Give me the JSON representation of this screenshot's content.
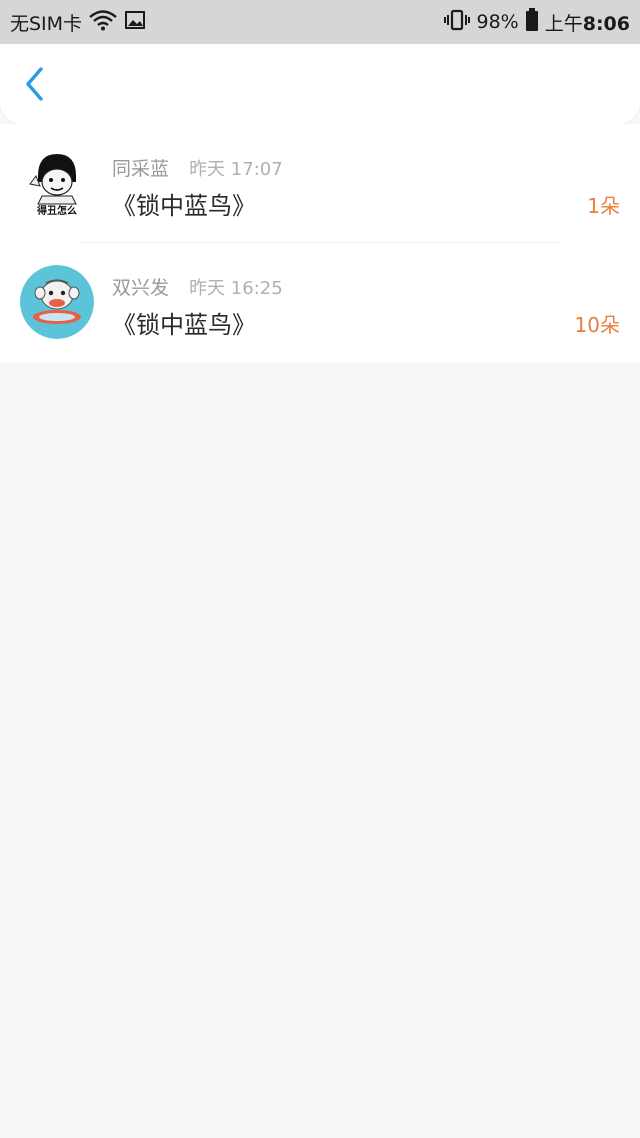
{
  "status_bar": {
    "carrier": "无SIM卡",
    "battery": "98%",
    "time_prefix": "上午",
    "time": "8:06"
  },
  "nav": {
    "accent_color": "#2a9ae3"
  },
  "messages": [
    {
      "name": "同采蓝",
      "time": "昨天 17:07",
      "title": "《锁中蓝鸟》",
      "count": "1朵",
      "avatar_label": "得丑怎么"
    },
    {
      "name": "双兴发",
      "time": "昨天 16:25",
      "title": "《锁中蓝鸟》",
      "count": "10朵"
    }
  ],
  "colors": {
    "count": "#e8803a",
    "background": "#f7f7f7"
  }
}
